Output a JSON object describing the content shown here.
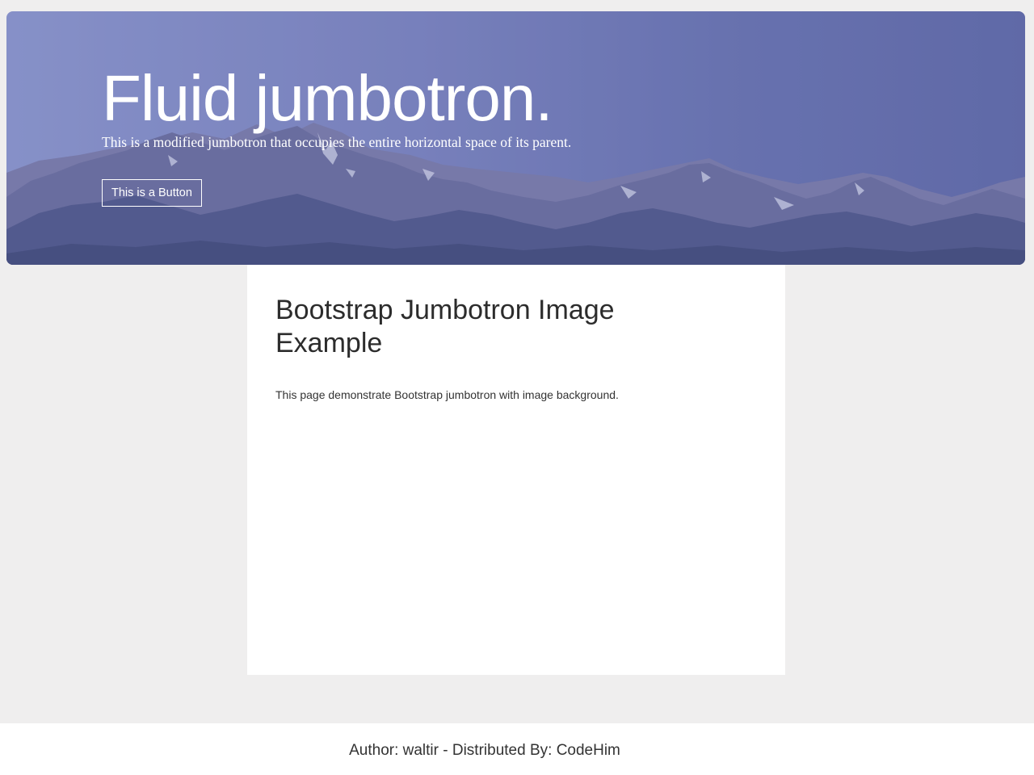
{
  "jumbotron": {
    "title": "Fluid jumbotron.",
    "lead": "This is a modified jumbotron that occupies the entire horizontal space of its parent.",
    "button_label": "This is a Button"
  },
  "main": {
    "title": "Bootstrap Jumbotron Image Example",
    "text": "This page demonstrate Bootstrap jumbotron with image background."
  },
  "footer": {
    "text": "Author: waltir - Distributed By: CodeHim"
  }
}
